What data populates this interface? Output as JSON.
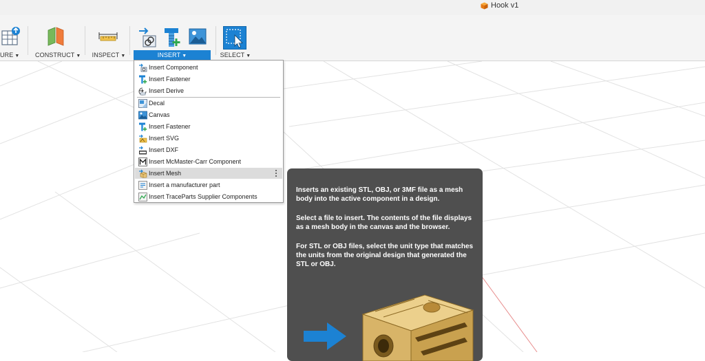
{
  "document": {
    "title": "Hook v1"
  },
  "toolbar": {
    "groups": [
      {
        "label": "URE",
        "icon": "create-table-icon"
      },
      {
        "label": "CONSTRUCT",
        "icon": "construct-plane-icon"
      },
      {
        "label": "INSPECT",
        "icon": "measure-ruler-icon"
      },
      {
        "label": "INSERT",
        "icon": "insert-icons",
        "active": true
      },
      {
        "label": "SELECT",
        "icon": "select-arrow-icon"
      }
    ],
    "accent": "#1c82d3"
  },
  "insert_menu": {
    "items": [
      {
        "label": "Insert Component",
        "icon": "insert-component-icon"
      },
      {
        "label": "Insert Fastener",
        "icon": "insert-fastener-icon"
      },
      {
        "label": "Insert Derive",
        "icon": "insert-derive-icon"
      },
      {
        "label": "Decal",
        "icon": "decal-icon"
      },
      {
        "label": "Canvas",
        "icon": "canvas-image-icon"
      },
      {
        "label": "Insert Fastener",
        "icon": "insert-fastener-icon"
      },
      {
        "label": "Insert SVG",
        "icon": "insert-svg-icon"
      },
      {
        "label": "Insert DXF",
        "icon": "insert-dxf-icon"
      },
      {
        "label": "Insert McMaster-Carr Component",
        "icon": "mcmaster-icon"
      },
      {
        "label": "Insert Mesh",
        "icon": "insert-mesh-icon",
        "highlighted": true
      },
      {
        "label": "Insert a manufacturer part",
        "icon": "manufacturer-part-icon"
      },
      {
        "label": "Insert TraceParts Supplier Components",
        "icon": "traceparts-icon"
      }
    ]
  },
  "tooltip": {
    "paragraphs": [
      "Inserts an existing STL, OBJ, or 3MF file as a mesh body into the active component in a design.",
      "Select a file to insert. The contents of the file displays as a mesh body in the canvas and the browser.",
      "For STL or OBJ files, select the unit type that matches the units from the original design that generated the STL or OBJ."
    ]
  }
}
